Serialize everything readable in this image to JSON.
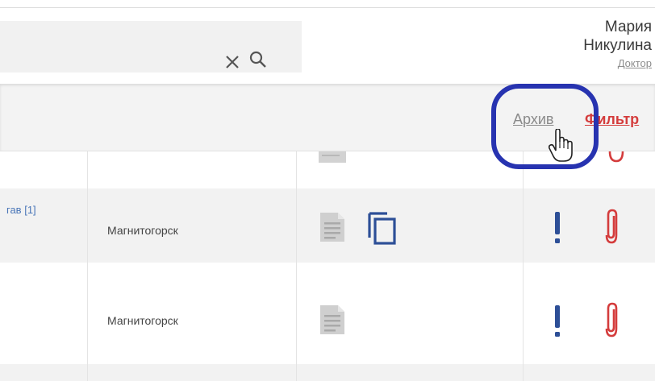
{
  "header": {
    "search": {
      "value": "",
      "placeholder": ""
    },
    "user": {
      "first_name": "Мария",
      "last_name": "Никулина",
      "role": "Доктор"
    }
  },
  "toolbar": {
    "archive_label": "Архив",
    "filter_label": "Фильтр"
  },
  "table": {
    "rows": [
      {
        "name_fragment": "",
        "city": "",
        "has_document": true,
        "has_copy": false,
        "has_alert": false,
        "has_attachment": true
      },
      {
        "name_fragment": "гав [1]",
        "city": "Магнитогорск",
        "has_document": true,
        "has_copy": true,
        "has_alert": true,
        "has_attachment": true
      },
      {
        "name_fragment": "",
        "city": "Магнитогорск",
        "has_document": true,
        "has_copy": false,
        "has_alert": true,
        "has_attachment": true
      }
    ]
  },
  "colors": {
    "accent_red": "#d43c3c",
    "alert_blue": "#2d4f97",
    "link_blue": "#4a76b8",
    "highlight_ring": "#2733b0",
    "doc_gray": "#c9c9c9"
  },
  "icons": [
    "clear-icon",
    "search-icon",
    "hand-cursor-icon",
    "document-icon",
    "copy-icon",
    "alert-icon",
    "paperclip-icon"
  ]
}
